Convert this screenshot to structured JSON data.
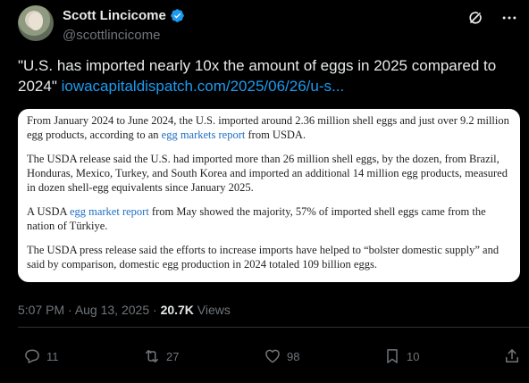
{
  "author": {
    "display_name": "Scott Lincicome",
    "handle": "@scottlincicome"
  },
  "icons": {
    "verified": "verified-badge-icon",
    "grok": "grok-icon",
    "more": "more-icon"
  },
  "tweet": {
    "text": "\"U.S. has imported nearly 10x the amount of eggs in 2025 compared to 2024\"",
    "link": "iowacapitaldispatch.com/2025/06/26/u-s..."
  },
  "card": {
    "p1_a": "From January 2024 to June 2024, the U.S. imported around 2.36 million shell eggs and just over 9.2 million egg products, according to an ",
    "p1_link": "egg markets report",
    "p1_b": " from USDA.",
    "p2": "The USDA release said the U.S. had imported more than 26 million shell eggs, by the dozen, from Brazil, Honduras, Mexico, Turkey, and South Korea and imported an additional 14 million egg products, measured in dozen shell-egg equivalents since January 2025.",
    "p3_a": "A USDA ",
    "p3_link": "egg market report",
    "p3_b": " from May showed the majority, 57% of imported shell eggs came from the nation of Türkiye.",
    "p4": "The USDA press release said the efforts to increase imports have helped to “bolster domestic supply” and said by comparison, domestic egg production in 2024 totaled 109 billion eggs."
  },
  "meta": {
    "time": "5:07 PM",
    "sep1": " · ",
    "date": "Aug 13, 2025",
    "sep2": " · ",
    "views": "20.7K",
    "views_label": " Views"
  },
  "actions": {
    "replies": "11",
    "reposts": "27",
    "likes": "98",
    "bookmarks": "10"
  },
  "colors": {
    "background": "#000000",
    "text": "#e7e9ea",
    "secondary": "#71767b",
    "link": "#1d9bf0",
    "verified": "#1d9bf0"
  }
}
